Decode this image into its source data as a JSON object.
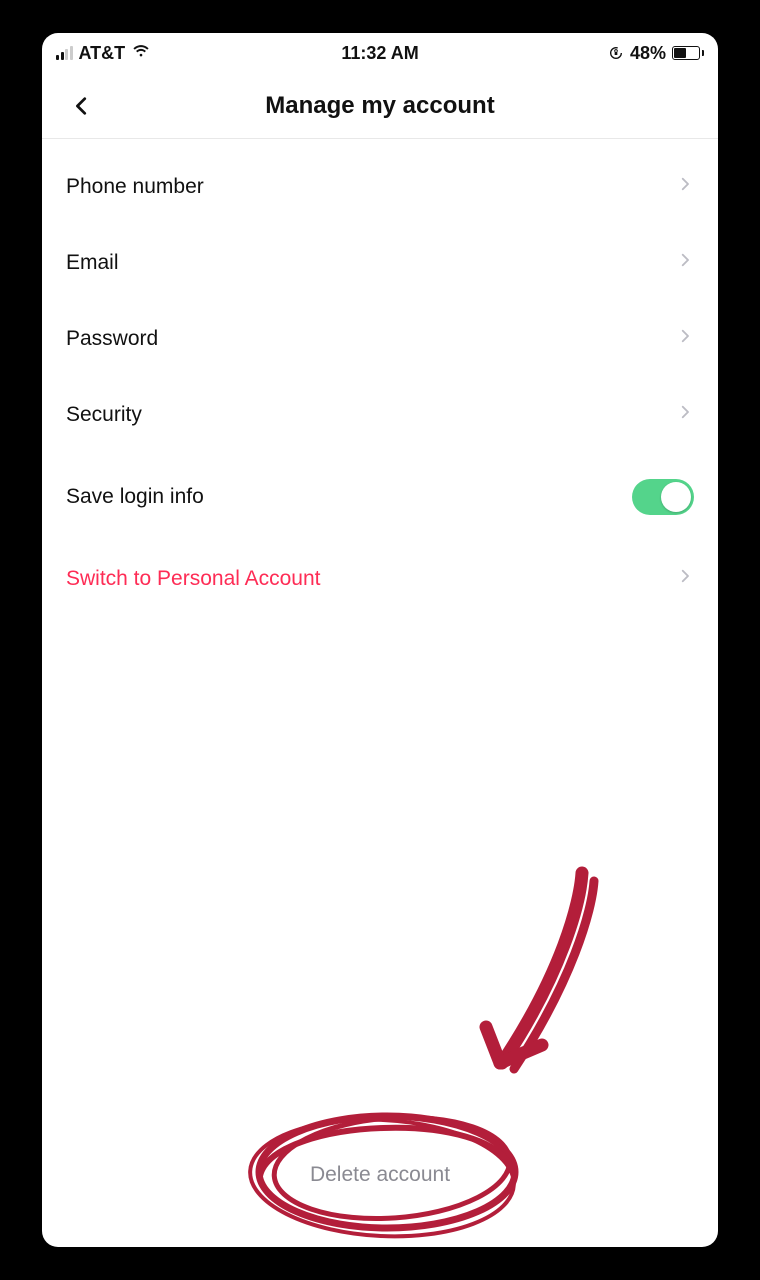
{
  "status_bar": {
    "carrier": "AT&T",
    "time": "11:32 AM",
    "battery_pct": "48%"
  },
  "header": {
    "title": "Manage my account"
  },
  "rows": {
    "phone": "Phone number",
    "email": "Email",
    "password": "Password",
    "security": "Security",
    "save_login": "Save login info",
    "switch_personal": "Switch to Personal Account"
  },
  "toggle": {
    "save_login_on": true
  },
  "footer": {
    "delete": "Delete account"
  },
  "colors": {
    "accent_red": "#fe2c55",
    "toggle_green": "#54d48b",
    "annotation": "#b31e3a"
  }
}
